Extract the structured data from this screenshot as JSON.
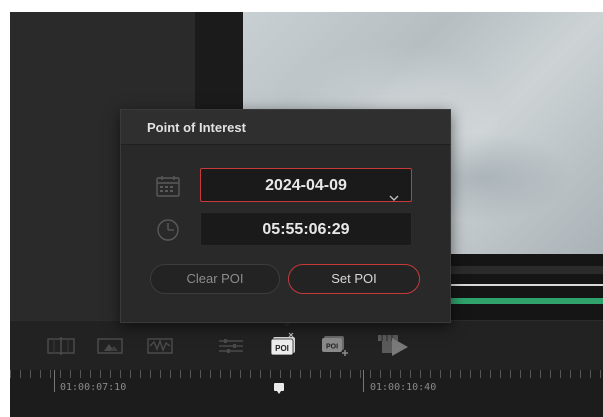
{
  "popup": {
    "title": "Point of Interest",
    "date_value": "2024-04-09",
    "time_value": "05:55:06:29",
    "clear_label": "Clear POI",
    "set_label": "Set POI"
  },
  "toolbar": {
    "poi_icon_text": "POI",
    "poi_add_icon_text": "POI"
  },
  "ruler": {
    "timecode_left": "01:00:07:10",
    "timecode_right": "01:00:10:40"
  },
  "colors": {
    "accent_red": "#c63a3a",
    "track_green": "#2fa36b"
  },
  "icons": [
    "calendar-icon",
    "clock-icon",
    "chevron-down-icon",
    "poi-icon",
    "poi-add-icon",
    "play-clip-icon",
    "sliders-icon",
    "waveform-icon",
    "image-icon",
    "split-icon"
  ]
}
